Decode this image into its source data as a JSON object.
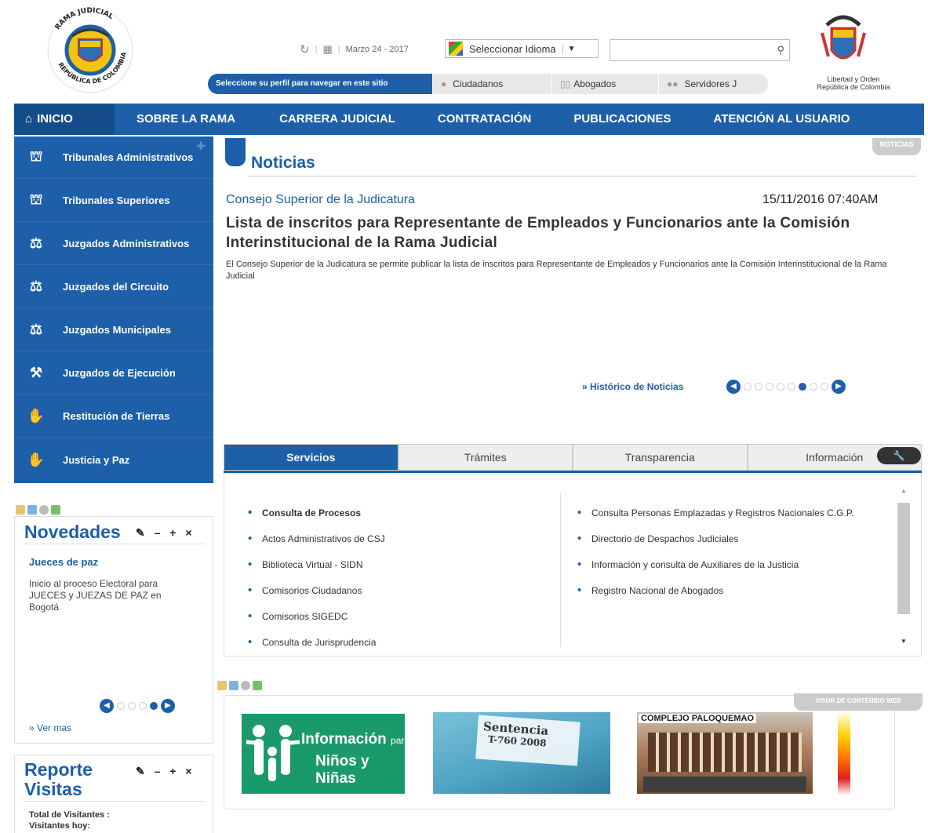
{
  "header": {
    "date": "Marzo 24 - 2017",
    "language_select": "Seleccionar Idioma",
    "search_placeholder": "",
    "profile_prompt": "Seleccione su perfil para navegar en este sitio",
    "profiles": [
      "Ciudadanos",
      "Abogados",
      "Servidores J"
    ],
    "emblem_left_text": "RAMA JUDICIAL · REPÚBLICA DE COLOMBIA",
    "emblem_right_line1": "Libertad y Orden",
    "emblem_right_line2": "República de Colombia"
  },
  "nav": {
    "items": [
      "INICIO",
      "SOBRE LA RAMA",
      "CARRERA JUDICIAL",
      "CONTRATACIÓN",
      "PUBLICACIONES",
      "ATENCIÓN AL USUARIO"
    ]
  },
  "sidebar": {
    "items": [
      {
        "label": "Tribunales Administrativos",
        "icon": "building-icon"
      },
      {
        "label": "Tribunales Superiores",
        "icon": "building-icon"
      },
      {
        "label": "Juzgados Administrativos",
        "icon": "scales-icon"
      },
      {
        "label": "Juzgados del Circuito",
        "icon": "scales-icon"
      },
      {
        "label": "Juzgados Municipales",
        "icon": "scales-icon"
      },
      {
        "label": "Juzgados de Ejecución",
        "icon": "gavel-icon"
      },
      {
        "label": "Restitución de Tierras",
        "icon": "handshake-icon"
      },
      {
        "label": "Justicia y Paz",
        "icon": "handshake-icon"
      }
    ]
  },
  "novedades": {
    "title": "Novedades",
    "controls": "✎ – + ×",
    "item_title": "Jueces de paz",
    "item_text": "Inicio al proceso Electoral para JUECES y JUEZAS DE PAZ en Bogotá",
    "ver_mas": "» Ver mas"
  },
  "reporte": {
    "title_line1": "Reporte",
    "title_line2": "Visitas",
    "controls": "✎ – + ×",
    "total_label": "Total de Visitantes :",
    "hoy_label": "Visitantes hoy:"
  },
  "news": {
    "section_title": "Noticias",
    "badge": "NOTICIAS",
    "source": "Consejo Superior de la Judicatura",
    "date": "15/11/2016 07:40AM",
    "headline": "Lista de inscritos para Representante de Empleados y Funcionarios ante la Comisión Interinstitucional de la Rama Judicial",
    "summary": "El Consejo Superior de la Judicatura se permite publicar la lista de inscritos para Representante de Empleados y Funcionarios ante la Comisión Interinstitucional de la Rama Judicial",
    "historico": "» Histórico de Noticias",
    "carousel_dots": 8,
    "carousel_active_index": 5
  },
  "tabs": {
    "items": [
      "Servicios",
      "Trámites",
      "Transparencia",
      "Información"
    ],
    "active": "Servicios"
  },
  "services": {
    "left": [
      "Consulta de Procesos",
      "Actos Administrativos de CSJ",
      "Biblioteca Virtual - SIDN",
      "Comisorios Ciudadanos",
      "Comisorios SIGEDC",
      "Consulta de Jurisprudencia"
    ],
    "right": [
      "Consulta Personas Emplazadas y Registros Nacionales C.G.P.",
      "Directorio de Despachos Judiciales",
      "Información y consulta de Auxiliares de la Justicia",
      "Registro Nacional de Abogados"
    ]
  },
  "banners": {
    "badge": "VISOR DE CONTENIDO WEB",
    "items": [
      {
        "line1": "Información",
        "line1_suffix": "para",
        "line2": "Niños y Niñas"
      },
      {
        "line1": "Sentencia",
        "line2": "T-760 2008"
      },
      {
        "line1": "COMPLEJO PALOQUEMAO"
      }
    ]
  },
  "colors": {
    "brand_blue": "#1d5fa8",
    "nav_active": "#154c8a"
  }
}
